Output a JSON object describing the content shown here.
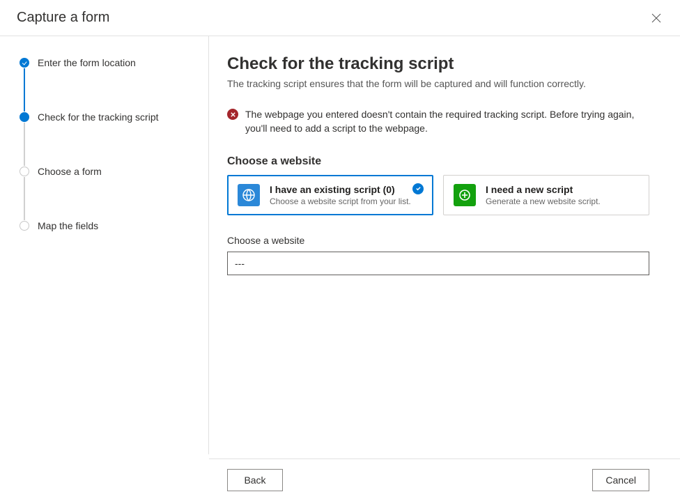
{
  "header": {
    "title": "Capture a form"
  },
  "steps": [
    {
      "label": "Enter the form location",
      "state": "completed"
    },
    {
      "label": "Check for the tracking script",
      "state": "active"
    },
    {
      "label": "Choose a form",
      "state": "todo"
    },
    {
      "label": "Map the fields",
      "state": "todo"
    }
  ],
  "main": {
    "heading": "Check for the tracking script",
    "subtitle": "The tracking script ensures that the form will be captured and will function correctly.",
    "error_message": "The webpage you entered doesn't contain the required tracking script. Before trying again, you'll need to add a script to the webpage.",
    "section_choose_website": "Choose a website",
    "options": {
      "existing": {
        "title": "I have an existing script (0)",
        "desc": "Choose a website script from your list.",
        "icon": "globe-icon",
        "selected": true
      },
      "new": {
        "title": "I need a new script",
        "desc": "Generate a new website script.",
        "icon": "add-circle-icon",
        "selected": false
      }
    },
    "website_field": {
      "label": "Choose a website",
      "value": "---"
    }
  },
  "footer": {
    "back": "Back",
    "cancel": "Cancel"
  },
  "colors": {
    "primary": "#0078d4",
    "error": "#a4262c",
    "green": "#13a10e"
  }
}
